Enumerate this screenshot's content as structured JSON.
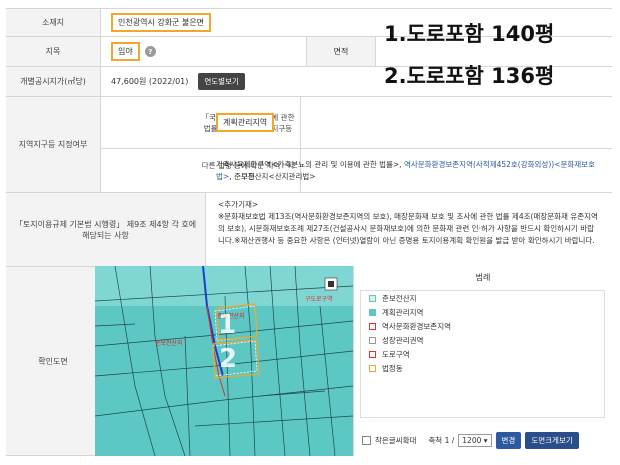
{
  "location": {
    "label": "소재지",
    "value": "인천광역시 강화군 불은면"
  },
  "land_category": {
    "label": "지목",
    "value": "임야",
    "help": "?",
    "area_label": "면적"
  },
  "official_price": {
    "label": "개별공시지가(㎡당)",
    "value": "47,600원 (2022/01)",
    "button": "연도별보기"
  },
  "zoning": {
    "label": "지역지구등 지정여부",
    "national_law_label": "「국토의 계획 및 이용에 관한 법률」에 따른 지역 · 지구등",
    "national_law_value": "계획관리지역",
    "other_law_label": "다른 법령 등에 따른 지역 · 지구등",
    "other_law_prefix": "가축사육제한구역<가축분뇨의 관리 및 이용에 관한 법률>, ",
    "other_law_link1": "역사문화환경보존지역(사적제452호(강화외성))<문화재보호법>",
    "other_law_suffix": ", 준보전산지<산지관리법>"
  },
  "land_use_reg": {
    "label": "「토지이용규제 기본법 시행령」 제9조 제4항 각 호에 해당되는 사항",
    "title": "<추가기재>",
    "body": "※문화재보호법 제13조(역사문화환경보존지역의 보호), 매장문화재 보호 및 조사에 관한 법률 제4조(매장문화재 유존지역의 보호), 시문화재보호조례 제27조(건설공사시 문화재보호)에 의한 문화재 관련 인·허가 사항을 반드시 확인하시기 바랍니다.※재산권행사 등 중요한 사항은 (인터넷)열람이 아닌 증명용 토지이용계획 확인원을 발급 받아 확인하시기 바랍니다."
  },
  "overlay": {
    "line1": "1.도로포함 140평",
    "line2": "2.도로포함 136평"
  },
  "map_section": {
    "label": "확인도면",
    "map_labels": {
      "n1": "1",
      "n2": "2",
      "forest": "준보전산지",
      "forest2": "준보전산지",
      "district": "구도로구역"
    }
  },
  "legend": {
    "title": "범례",
    "items": [
      {
        "label": "준보전산지",
        "color": "#d8f3ee"
      },
      {
        "label": "계획관리지역",
        "color": "#5dc7c4"
      },
      {
        "label": "역사문화환경보존지역",
        "color": "#ffffff"
      },
      {
        "label": "성장관리권역",
        "color": "#ffffff"
      },
      {
        "label": "도로구역",
        "color": "#ffffff"
      },
      {
        "label": "법정동",
        "color": "#ffffff"
      }
    ],
    "zoom_label": "작은글씨확대",
    "scale_label": "축척 1 /",
    "scale_value": "1200",
    "change_button": "변경",
    "enlarge_button": "도면크게보기"
  }
}
